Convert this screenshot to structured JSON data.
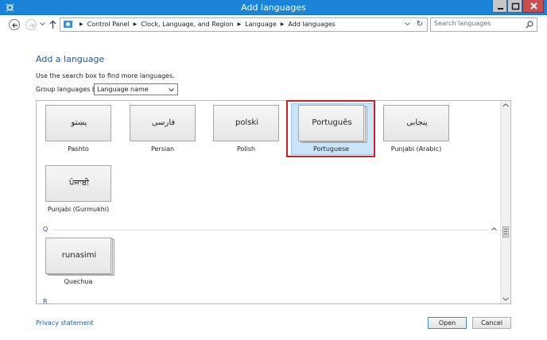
{
  "window": {
    "title": "Add languages",
    "app_icon": "control-panel-icon",
    "controls": [
      "minimize-icon",
      "maximize-icon",
      "close-icon"
    ]
  },
  "addressbar": {
    "breadcrumbs": [
      "Control Panel",
      "Clock, Language, and Region",
      "Language",
      "Add languages"
    ],
    "search_placeholder": "Search languages"
  },
  "content": {
    "heading": "Add a language",
    "hint": "Use the search box to find more languages.",
    "group_label": "Group languages by:",
    "group_value": "Language name"
  },
  "languages": [
    {
      "native": "پښتو",
      "english": "Pashto"
    },
    {
      "native": "فارسی",
      "english": "Persian"
    },
    {
      "native": "polski",
      "english": "Polish"
    },
    {
      "native": "Português",
      "english": "Portuguese",
      "selected": true
    },
    {
      "native": "پنجابی",
      "english": "Punjabi (Arabic)"
    },
    {
      "native": "ਪੰਜਾਬੀ",
      "english": "Punjabi (Gurmukhi)"
    },
    {
      "native": "runasimi",
      "english": "Quechua"
    }
  ],
  "sections": [
    "Q",
    "R"
  ],
  "footer": {
    "privacy": "Privacy statement",
    "open": "Open",
    "cancel": "Cancel"
  },
  "colors": {
    "titlebar": "#1b83d8",
    "link": "#1e5aa8",
    "highlight": "#d21f1f",
    "selection": "#cce4f7"
  }
}
